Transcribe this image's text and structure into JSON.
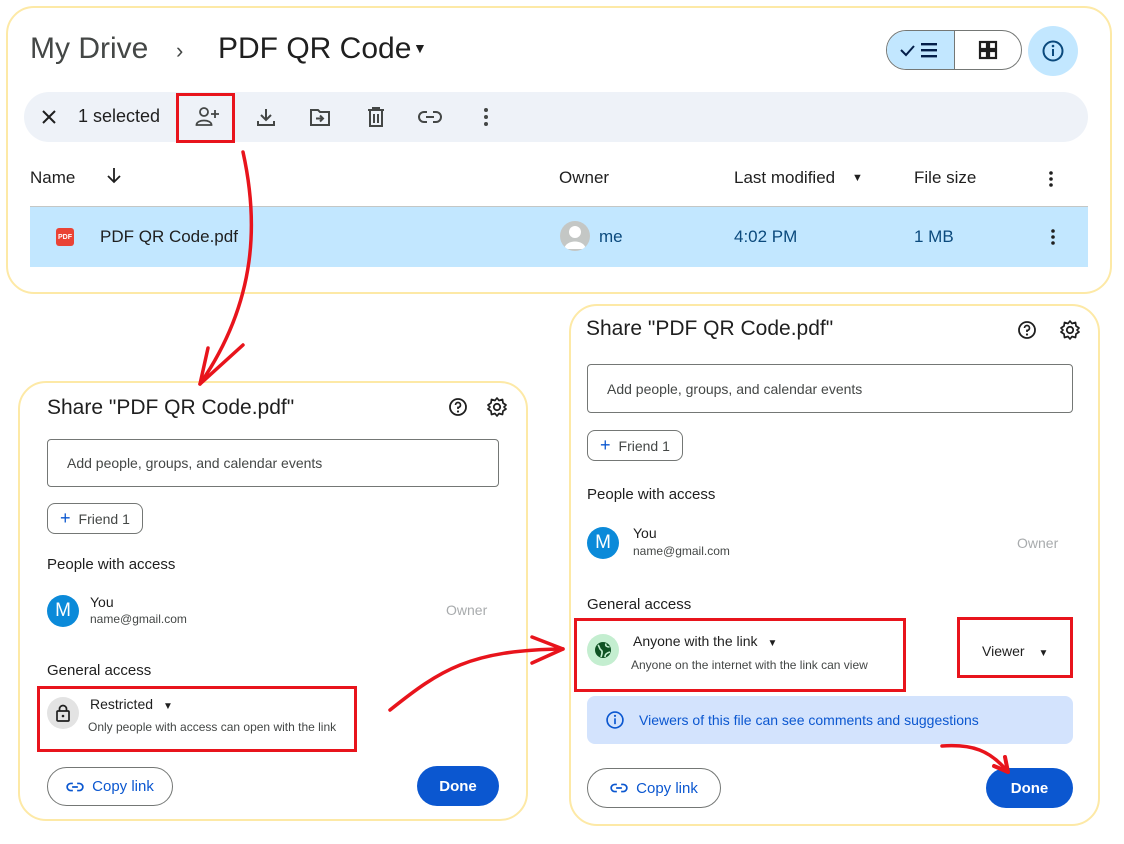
{
  "drive": {
    "breadcrumb_root": "My Drive",
    "breadcrumb_sep": "›",
    "breadcrumb_current": "PDF QR Code",
    "view_toggle": {
      "list_active": true
    },
    "toolbar": {
      "selected_label": "1 selected",
      "actions": [
        "close",
        "share",
        "download",
        "move",
        "trash",
        "copy-link",
        "more"
      ]
    },
    "table": {
      "columns": {
        "name": "Name",
        "owner": "Owner",
        "last_modified": "Last modified",
        "file_size": "File size"
      },
      "rows": [
        {
          "file_type": "PDF",
          "name": "PDF QR Code.pdf",
          "owner": "me",
          "last_modified": "4:02 PM",
          "file_size": "1 MB"
        }
      ]
    }
  },
  "share_before": {
    "title": "Share \"PDF QR Code.pdf\"",
    "input_placeholder": "Add people, groups, and calendar events",
    "suggestion_chip": "Friend 1",
    "people_heading": "People with access",
    "person": {
      "initial": "M",
      "name": "You",
      "email": "name@gmail.com",
      "role": "Owner"
    },
    "general_heading": "General access",
    "access": {
      "title": "Restricted",
      "description": "Only people with access can open with the link"
    },
    "copy_link": "Copy link",
    "done": "Done"
  },
  "share_after": {
    "title": "Share \"PDF QR Code.pdf\"",
    "input_placeholder": "Add people, groups, and calendar events",
    "suggestion_chip": "Friend 1",
    "people_heading": "People with access",
    "person": {
      "initial": "M",
      "name": "You",
      "email": "name@gmail.com",
      "role": "Owner"
    },
    "general_heading": "General access",
    "access": {
      "title": "Anyone with the link",
      "description": "Anyone on the internet with the link can view"
    },
    "role_select": "Viewer",
    "notice": "Viewers of this file can see comments and suggestions",
    "copy_link": "Copy link",
    "done": "Done"
  },
  "colors": {
    "accent": "#0b57d0",
    "selection": "#c2e7ff",
    "annotation_red": "#e8141c",
    "panel_border": "#fde9a6"
  }
}
